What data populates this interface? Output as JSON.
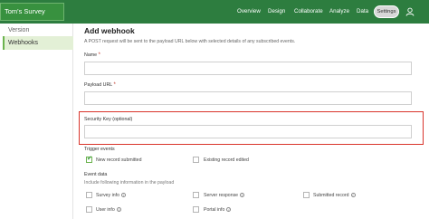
{
  "header": {
    "survey_title": "Tom's Survey",
    "nav": [
      "Overview",
      "Design",
      "Collaborate",
      "Analyze",
      "Data"
    ],
    "settings_label": "Settings",
    "bar_color": "#2d7d3f"
  },
  "sidebar": {
    "items": [
      {
        "label": "Version",
        "active": false
      },
      {
        "label": "Webhooks",
        "active": true
      }
    ]
  },
  "main": {
    "title": "Add webhook",
    "description": "A POST request will be sent to the payload URL below with selected details of any subscribed events.",
    "name_label": "Name",
    "name_required": "*",
    "payload_label": "Payload URL",
    "payload_required": "*",
    "security_key_label": "Security Key (optional)",
    "trigger_events_label": "Trigger events",
    "trigger_events": [
      {
        "label": "New record submitted",
        "checked": true
      },
      {
        "label": "Existing record edited",
        "checked": false
      }
    ],
    "event_data_label": "Event data",
    "event_data_desc": "Include following information in the payload",
    "event_data_options": [
      {
        "label": "Survey info",
        "checked": false
      },
      {
        "label": "Server response",
        "checked": false
      },
      {
        "label": "Submitted record",
        "checked": false
      },
      {
        "label": "User info",
        "checked": false
      },
      {
        "label": "Portal info",
        "checked": false
      }
    ]
  }
}
